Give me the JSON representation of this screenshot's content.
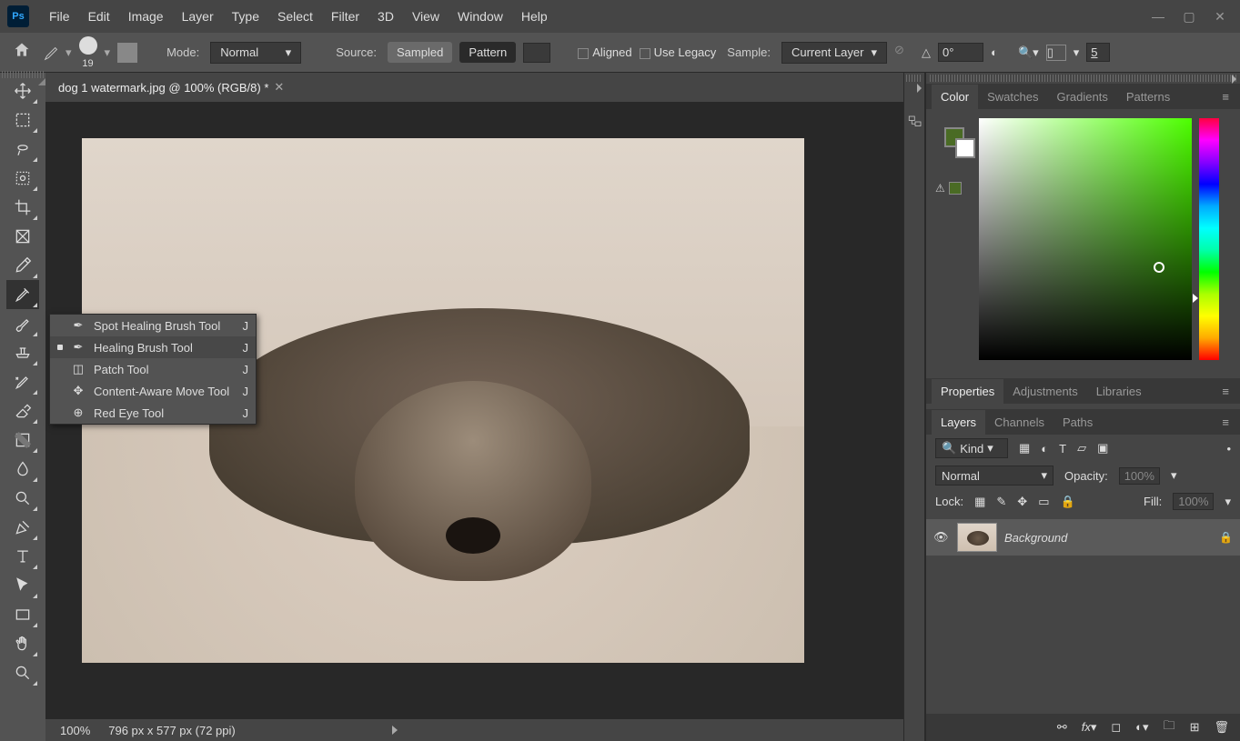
{
  "menubar": [
    "File",
    "Edit",
    "Image",
    "Layer",
    "Type",
    "Select",
    "Filter",
    "3D",
    "View",
    "Window",
    "Help"
  ],
  "options": {
    "brush_size": "19",
    "mode_label": "Mode:",
    "mode_value": "Normal",
    "source_label": "Source:",
    "sampled": "Sampled",
    "pattern": "Pattern",
    "aligned": "Aligned",
    "legacy": "Use Legacy",
    "sample_label": "Sample:",
    "sample_value": "Current Layer",
    "angle": "0°",
    "zoom_field": "5"
  },
  "doc": {
    "tab_title": "dog 1 watermark.jpg @ 100% (RGB/8) *"
  },
  "flyout": [
    {
      "label": "Spot Healing Brush Tool",
      "key": "J",
      "current": false
    },
    {
      "label": "Healing Brush Tool",
      "key": "J",
      "current": true
    },
    {
      "label": "Patch Tool",
      "key": "J",
      "current": false
    },
    {
      "label": "Content-Aware Move Tool",
      "key": "J",
      "current": false
    },
    {
      "label": "Red Eye Tool",
      "key": "J",
      "current": false
    }
  ],
  "status": {
    "zoom": "100%",
    "info": "796 px x 577 px (72 ppi)"
  },
  "panels": {
    "color_tabs": [
      "Color",
      "Swatches",
      "Gradients",
      "Patterns"
    ],
    "mid_tabs": [
      "Properties",
      "Adjustments",
      "Libraries"
    ],
    "layer_tabs": [
      "Layers",
      "Channels",
      "Paths"
    ],
    "layers": {
      "kind": "Kind",
      "blend": "Normal",
      "opacity_label": "Opacity:",
      "opacity": "100%",
      "lock_label": "Lock:",
      "fill_label": "Fill:",
      "fill": "100%",
      "bg_layer": "Background"
    }
  }
}
